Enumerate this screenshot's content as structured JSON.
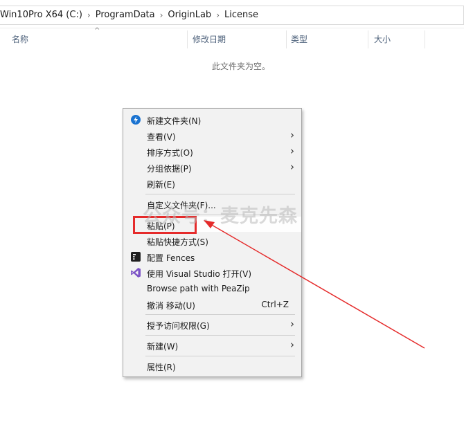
{
  "breadcrumb": {
    "items": [
      "Win10Pro X64 (C:)",
      "ProgramData",
      "OriginLab",
      "License"
    ]
  },
  "columns": {
    "name": "名称",
    "modified": "修改日期",
    "type": "类型",
    "size": "大小"
  },
  "folder": {
    "empty_message": "此文件夹为空。"
  },
  "context_menu": {
    "items": [
      {
        "label": "新建文件夹(N)",
        "icon": "new-folder-icon"
      },
      {
        "label": "查看(V)",
        "submenu": true
      },
      {
        "label": "排序方式(O)",
        "submenu": true
      },
      {
        "label": "分组依据(P)",
        "submenu": true
      },
      {
        "label": "刷新(E)"
      },
      {
        "label": "自定义文件夹(F)..."
      },
      {
        "label": "粘贴(P)",
        "highlighted": true
      },
      {
        "label": "粘贴快捷方式(S)"
      },
      {
        "label": "配置 Fences",
        "icon": "fences-icon"
      },
      {
        "label": "使用 Visual Studio 打开(V)",
        "icon": "visual-studio-icon"
      },
      {
        "label": "Browse path with PeaZip"
      },
      {
        "label": "撤消 移动(U)",
        "shortcut": "Ctrl+Z"
      },
      {
        "label": "授予访问权限(G)",
        "submenu": true
      },
      {
        "label": "新建(W)",
        "submenu": true
      },
      {
        "label": "属性(R)"
      }
    ]
  },
  "watermark": "公众号：麦克先森",
  "colors": {
    "highlight_border": "#e52b2b",
    "arrow": "#e52b2b",
    "new_folder_icon": "#1a73d1",
    "visual_studio_icon": "#7b52c6",
    "column_header_text": "#4c607a"
  }
}
